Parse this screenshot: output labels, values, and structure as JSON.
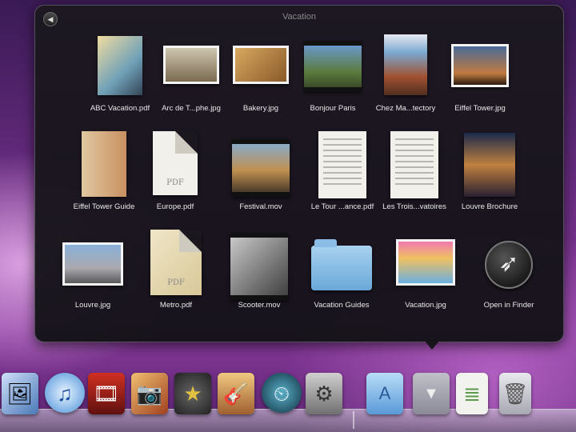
{
  "stack": {
    "title": "Vacation",
    "back_glyph": "◀",
    "items": [
      {
        "label": "ABC Vacation.pdf",
        "kind": "book"
      },
      {
        "label": "Arc de T...phe.jpg",
        "kind": "photo"
      },
      {
        "label": "Bakery.jpg",
        "kind": "photo"
      },
      {
        "label": "Bonjour Paris",
        "kind": "movie"
      },
      {
        "label": "Chez Ma...tectory",
        "kind": "book"
      },
      {
        "label": "Eiffel Tower.jpg",
        "kind": "photo"
      },
      {
        "label": "Eiffel Tower Guide",
        "kind": "book"
      },
      {
        "label": "Europe.pdf",
        "kind": "pdf"
      },
      {
        "label": "Festival.mov",
        "kind": "movie"
      },
      {
        "label": "Le Tour ...ance.pdf",
        "kind": "doc"
      },
      {
        "label": "Les Trois...vatoires",
        "kind": "doc"
      },
      {
        "label": "Louvre Brochure",
        "kind": "doc"
      },
      {
        "label": "Louvre.jpg",
        "kind": "photo"
      },
      {
        "label": "Metro.pdf",
        "kind": "pdf"
      },
      {
        "label": "Scooter.mov",
        "kind": "movie"
      },
      {
        "label": "Vacation Guides",
        "kind": "folder"
      },
      {
        "label": "Vacation.jpg",
        "kind": "photo"
      },
      {
        "label": "Open in Finder",
        "kind": "finder"
      }
    ],
    "pdf_mark": "PDF",
    "finder_glyph": "➶"
  },
  "dock": {
    "icons": [
      {
        "name": "preview-icon",
        "glyph": "🖼"
      },
      {
        "name": "itunes-icon",
        "glyph": "♫"
      },
      {
        "name": "photo-booth-icon",
        "glyph": "🎞"
      },
      {
        "name": "iphoto-icon",
        "glyph": "📷"
      },
      {
        "name": "imovie-icon",
        "glyph": "★"
      },
      {
        "name": "garageband-icon",
        "glyph": "🎸"
      },
      {
        "name": "time-machine-icon",
        "glyph": "⏲"
      },
      {
        "name": "system-preferences-icon",
        "glyph": "⚙"
      },
      {
        "name": "applications-folder-icon",
        "glyph": "A"
      },
      {
        "name": "downloads-stack-icon",
        "glyph": "▼"
      },
      {
        "name": "documents-stack-icon",
        "glyph": "≣"
      },
      {
        "name": "trash-icon",
        "glyph": "🗑"
      }
    ]
  }
}
